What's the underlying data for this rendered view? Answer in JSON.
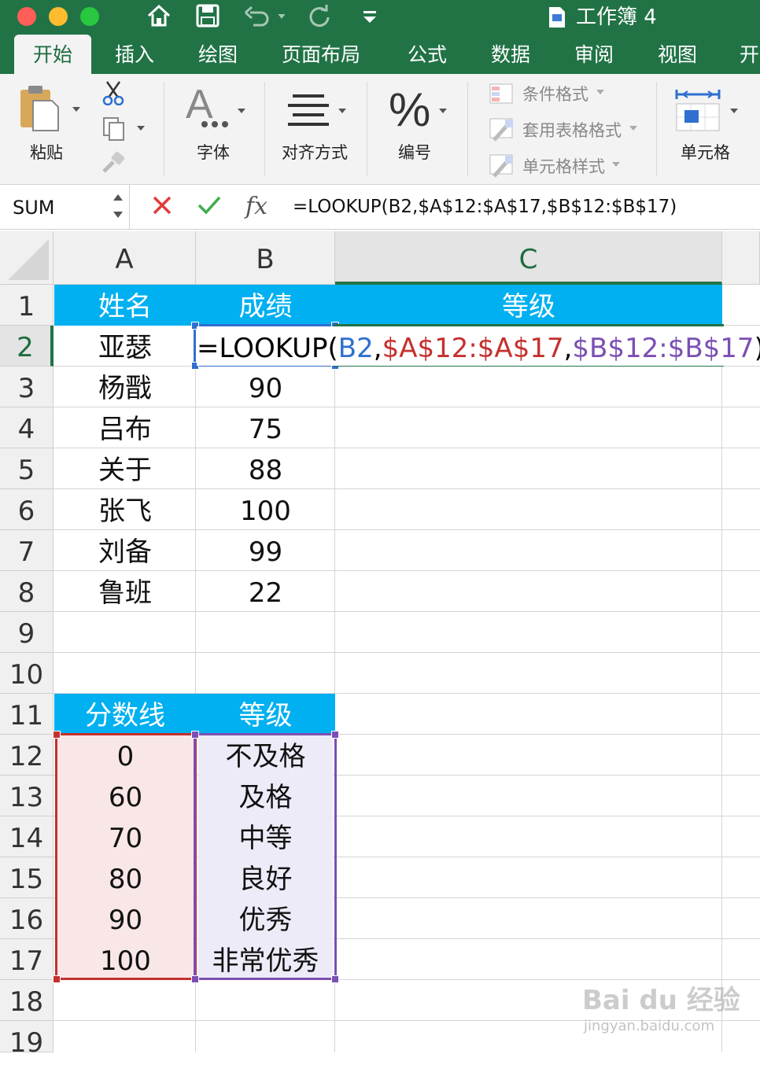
{
  "title_bar": {
    "doc_title": "工作簿 4",
    "traffic_colors": [
      "#ff5f57",
      "#febc2e",
      "#28c840"
    ],
    "quick_access_icons": [
      "home-icon",
      "save-icon",
      "undo-icon",
      "redo-icon",
      "customize-icon"
    ]
  },
  "tabs": [
    "开始",
    "插入",
    "绘图",
    "页面布局",
    "公式",
    "数据",
    "审阅",
    "视图",
    "开"
  ],
  "ribbon": {
    "paste": "粘贴",
    "font": "字体",
    "align": "对齐方式",
    "number": "编号",
    "cond_format": "条件格式",
    "table_format": "套用表格格式",
    "cell_styles": "单元格样式",
    "cells": "单元格"
  },
  "formula_bar": {
    "name_box": "SUM",
    "fx": "fx",
    "formula": "=LOOKUP(B2,$A$12:$A$17,$B$12:$B$17)"
  },
  "columns": [
    "A",
    "B",
    "C"
  ],
  "rows": [
    "1",
    "2",
    "3",
    "4",
    "5",
    "6",
    "7",
    "8",
    "9",
    "10",
    "11",
    "12",
    "13",
    "14",
    "15",
    "16",
    "17",
    "18",
    "19"
  ],
  "sheet": {
    "headers1": {
      "name": "姓名",
      "score": "成绩",
      "grade": "等级"
    },
    "edit_formula": {
      "prefix": "=LOOKUP(",
      "ref1": "B2",
      "comma1": ",",
      "ref2": "$A$12:$A$17",
      "comma2": ",",
      "ref3": "$B$12:$B$17",
      "suffix": ")"
    },
    "students": [
      {
        "name": "亚瑟",
        "score": ""
      },
      {
        "name": "杨戬",
        "score": "90"
      },
      {
        "name": "吕布",
        "score": "75"
      },
      {
        "name": "关于",
        "score": "88"
      },
      {
        "name": "张飞",
        "score": "100"
      },
      {
        "name": "刘备",
        "score": "99"
      },
      {
        "name": "鲁班",
        "score": "22"
      }
    ],
    "headers2": {
      "threshold": "分数线",
      "grade": "等级"
    },
    "lookup_table": [
      {
        "threshold": "0",
        "grade": "不及格"
      },
      {
        "threshold": "60",
        "grade": "及格"
      },
      {
        "threshold": "70",
        "grade": "中等"
      },
      {
        "threshold": "80",
        "grade": "良好"
      },
      {
        "threshold": "90",
        "grade": "优秀"
      },
      {
        "threshold": "100",
        "grade": "非常优秀"
      }
    ]
  },
  "watermark": {
    "line1": "Bai du 经验",
    "line2": "jingyan.baidu.com"
  },
  "colors": {
    "excel_green": "#217346",
    "header_fill": "#00b0f0",
    "ref_blue": "#2e6fcf",
    "ref_red": "#c5302e",
    "ref_purple": "#7b4fb3"
  }
}
